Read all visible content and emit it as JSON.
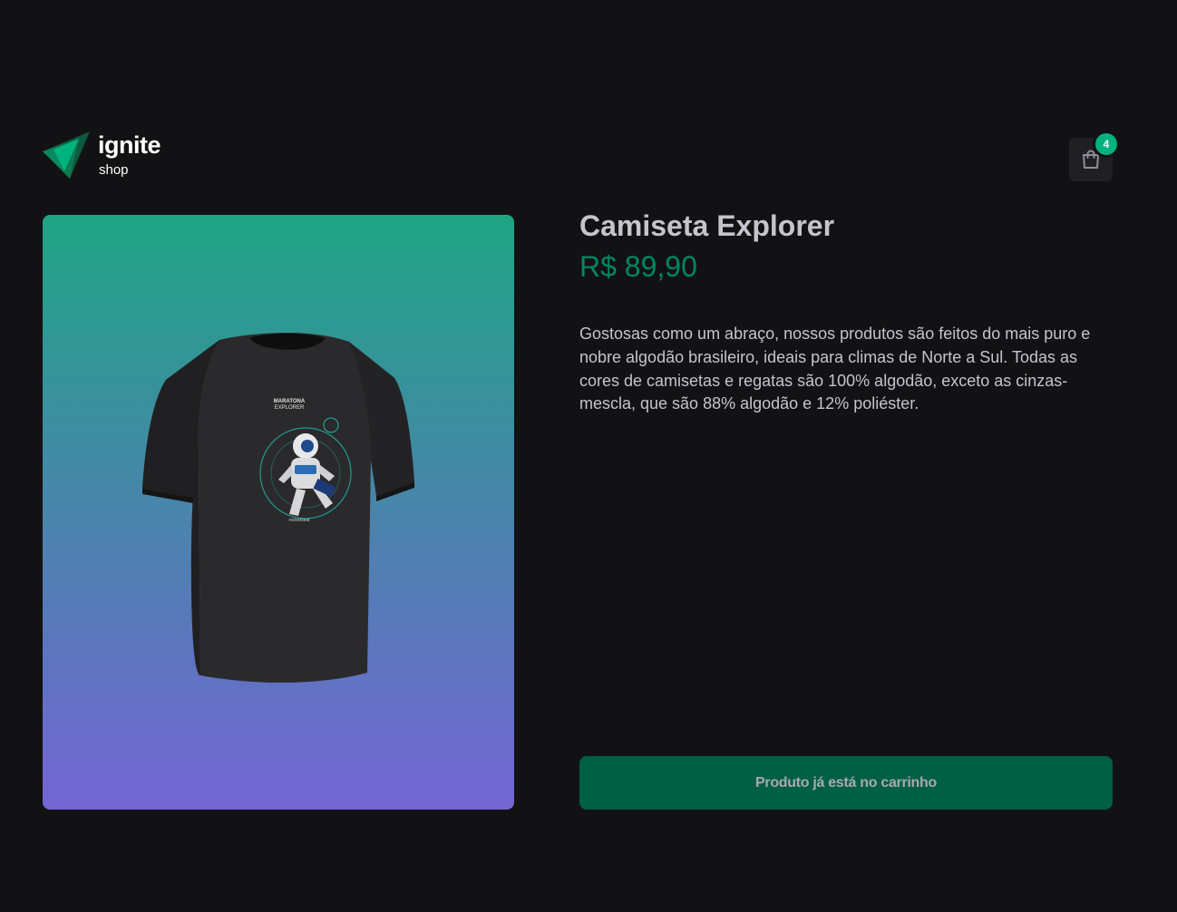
{
  "header": {
    "logo": {
      "word": "ignite",
      "sub": "shop"
    },
    "cart": {
      "icon": "handbag-icon",
      "count": "4"
    }
  },
  "product": {
    "image_alt": "Camiseta Explorer",
    "name": "Camiseta Explorer",
    "price": "R$ 89,90",
    "description": "Gostosas como um abraço, nossos produtos são feitos do mais puro e nobre algodão brasileiro, ideais para climas de Norte a Sul. Todas as cores de camisetas e regatas são 100% algodão, exceto as cinzas-mescla, que são 88% algodão e 12% poliéster.",
    "button_label": "Produto já está no carrinho"
  },
  "colors": {
    "background": "#121214",
    "accent": "#00b37e",
    "price": "#00875f",
    "button_disabled": "#015f43",
    "gradient_top": "#1ea483",
    "gradient_bottom": "#7465d4"
  }
}
